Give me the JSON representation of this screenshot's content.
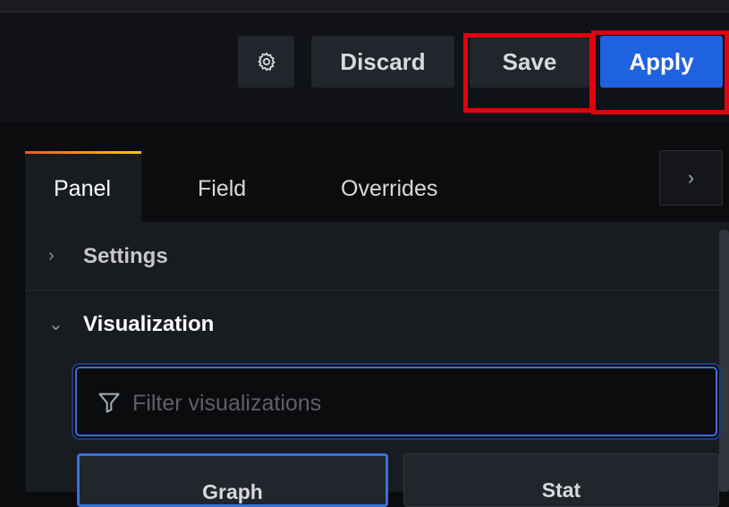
{
  "toolbar": {
    "settings_icon": "gear-icon",
    "discard_label": "Discard",
    "save_label": "Save",
    "apply_label": "Apply",
    "apply_color": "#1f62e0",
    "highlight_color": "#e3000f"
  },
  "tabs": [
    {
      "label": "Panel",
      "active": true
    },
    {
      "label": "Field",
      "active": false
    },
    {
      "label": "Overrides",
      "active": false
    }
  ],
  "expand_icon": "chevron-right-icon",
  "sections": {
    "settings": {
      "label": "Settings",
      "expanded": false
    },
    "visualization": {
      "label": "Visualization",
      "expanded": true
    }
  },
  "filter": {
    "placeholder": "Filter visualizations",
    "value": "",
    "icon": "filter-icon"
  },
  "visualizations": [
    {
      "label": "Graph",
      "selected": true
    },
    {
      "label": "Stat",
      "selected": false
    }
  ]
}
